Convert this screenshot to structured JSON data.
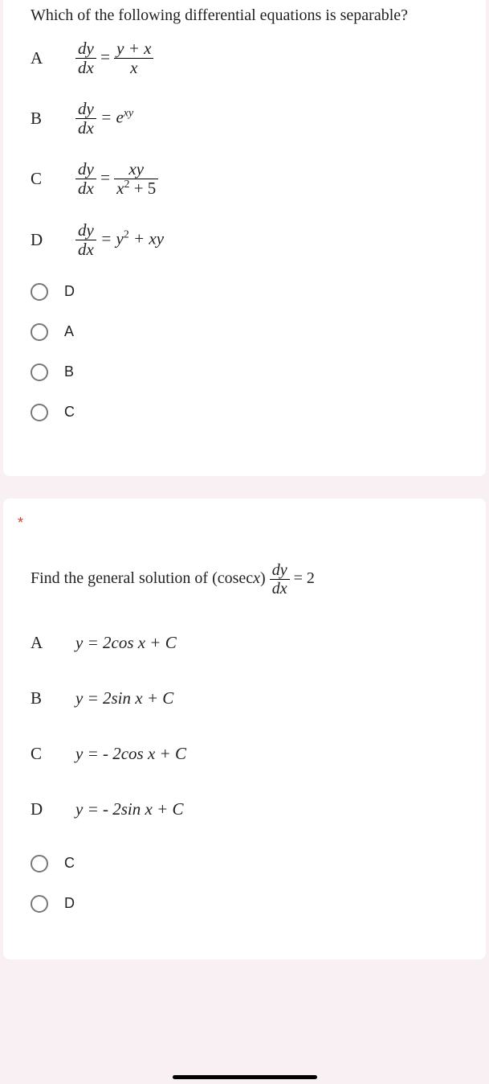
{
  "q1": {
    "prompt": "Which of the following differential equations is separable?",
    "rows": [
      {
        "label": "A"
      },
      {
        "label": "B"
      },
      {
        "label": "C"
      },
      {
        "label": "D"
      }
    ],
    "eqA": {
      "num1": "dy",
      "den1": "dx",
      "eq": "=",
      "num2": "y + x",
      "den2": "x"
    },
    "eqB": {
      "num1": "dy",
      "den1": "dx",
      "eq": "= e",
      "exp": "xy"
    },
    "eqC": {
      "num1": "dy",
      "den1": "dx",
      "eq": "=",
      "num2": "xy",
      "den2": "x",
      "sup2": "2",
      "den2b": " + 5"
    },
    "eqD": {
      "num1": "dy",
      "den1": "dx",
      "eq": "= y",
      "sup": "2",
      "rest": " + xy"
    },
    "choices": [
      "D",
      "A",
      "B",
      "C"
    ]
  },
  "q2": {
    "required": "*",
    "promptA": "Find the general solution of ",
    "promptB": "(cosec",
    "promptC": ")",
    "promptX": "x",
    "frac": {
      "num": "dy",
      "den": "dx"
    },
    "promptD": " = 2",
    "rows": [
      {
        "label": "A",
        "text": "y = 2cos x + C",
        "neg": false,
        "fn": "cos"
      },
      {
        "label": "B",
        "text": "y = 2sin x + C",
        "neg": false,
        "fn": "sin"
      },
      {
        "label": "C",
        "text": "y = - 2cos x + C",
        "neg": true,
        "fn": "cos"
      },
      {
        "label": "D",
        "text": "y = - 2sin x + C",
        "neg": true,
        "fn": "sin"
      }
    ],
    "choices": [
      "C",
      "D"
    ]
  }
}
